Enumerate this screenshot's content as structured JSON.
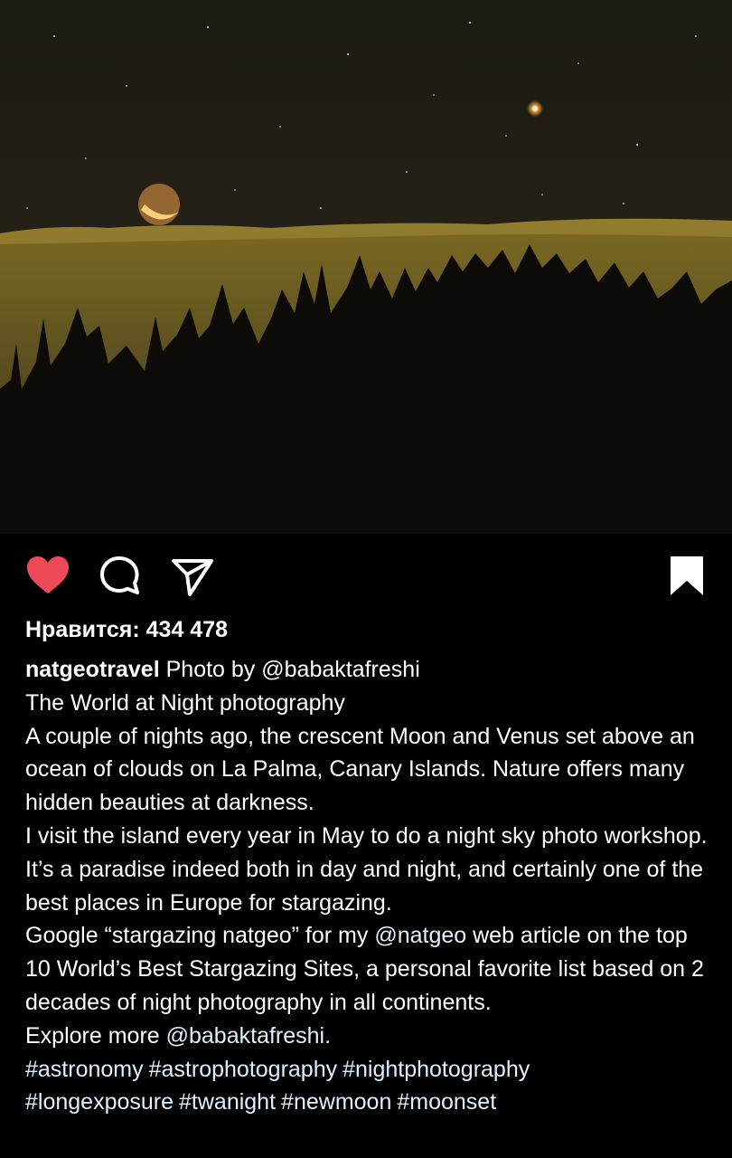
{
  "post": {
    "photo_alt": "Crescent Moon and Venus setting above clouds on La Palma",
    "likes_label": "Нравится: 434 478",
    "username": "natgeotravel",
    "caption": {
      "intro": "Photo by",
      "credit": "@babaktafreshi",
      "title": "The World at Night photography",
      "para1": "A couple of nights ago, the crescent Moon and Venus set above an ocean of clouds on La Palma, Canary Islands. Nature offers many hidden beauties at darkness.",
      "para2": "I visit the island every year in May to do a night sky photo workshop. It’s a paradise indeed both in day and night, and certainly one of the best places in Europe for stargazing.",
      "para3_a": "Google “stargazing natgeo” for my",
      "para3_mention": "@natgeo",
      "para3_b": "web article on the top 10 World’s Best Stargazing Sites, a personal favorite list based on 2 decades of night photography in all continents.",
      "explore": "Explore more",
      "explore_mention": "@babaktafreshi.",
      "hashtags_line1": [
        "#astronomy",
        "#astrophotography",
        "#nightphotography"
      ],
      "hashtags_line2": [
        "#longexposure",
        "#twanight",
        "#newmoon",
        "#moonset"
      ]
    }
  },
  "icons": {
    "like": "heart-filled-icon",
    "comment": "comment-bubble-icon",
    "share": "paper-plane-icon",
    "save": "bookmark-filled-icon"
  },
  "colors": {
    "background": "#000000",
    "like_red": "#ed4956",
    "link": "#e0f1ff"
  }
}
